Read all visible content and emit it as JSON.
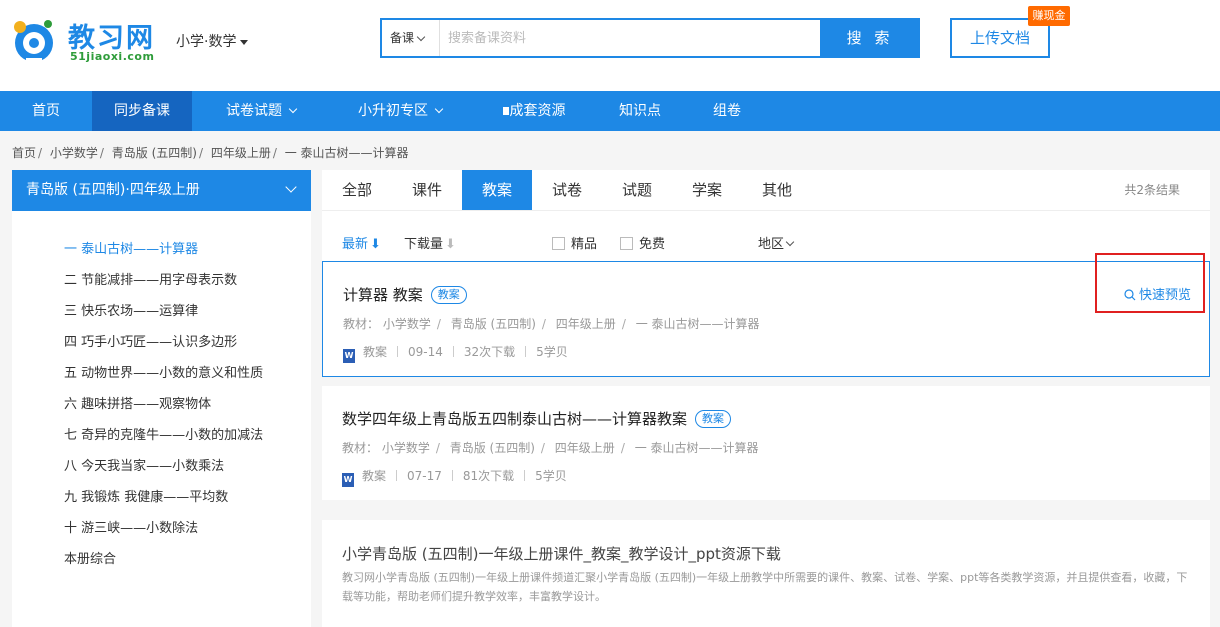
{
  "header": {
    "logo_text": "教习网",
    "logo_sub": "51jiaoxi.com",
    "subject": "小学·数学",
    "search_type": "备课",
    "search_placeholder": "搜索备课资料",
    "search_button": "搜 索",
    "upload_button": "上传文档",
    "earn_badge": "赚现金",
    "brand_color": "#1e88e5"
  },
  "nav": {
    "items": [
      {
        "label": "首页"
      },
      {
        "label": "同步备课"
      },
      {
        "label": "试卷试题"
      },
      {
        "label": "小升初专区"
      },
      {
        "label": "成套资源"
      },
      {
        "label": "知识点"
      },
      {
        "label": "组卷"
      }
    ],
    "active": "同步备课"
  },
  "breadcrumb": [
    "首页",
    "小学数学",
    "青岛版 (五四制)",
    "四年级上册",
    "一 泰山古树——计算器"
  ],
  "sidebar": {
    "header": "青岛版 (五四制)·四年级上册",
    "items": [
      {
        "label": "一 泰山古树——计算器"
      },
      {
        "label": "二 节能减排——用字母表示数"
      },
      {
        "label": "三 快乐农场——运算律"
      },
      {
        "label": "四 巧手小巧匠——认识多边形"
      },
      {
        "label": "五 动物世界——小数的意义和性质"
      },
      {
        "label": "六 趣味拼搭——观察物体"
      },
      {
        "label": "七 奇异的克隆牛——小数的加减法"
      },
      {
        "label": "八 今天我当家——小数乘法"
      },
      {
        "label": "九 我锻炼 我健康——平均数"
      },
      {
        "label": "十 游三峡——小数除法"
      },
      {
        "label": "本册综合"
      }
    ],
    "active_index": 0
  },
  "tabs": {
    "items": [
      {
        "label": "全部"
      },
      {
        "label": "课件"
      },
      {
        "label": "教案"
      },
      {
        "label": "试卷"
      },
      {
        "label": "试题"
      },
      {
        "label": "学案"
      },
      {
        "label": "其他"
      }
    ],
    "active": "教案",
    "total": "共2条结果"
  },
  "filters": {
    "newest": "最新",
    "newest_arrow": "⬇",
    "downloads": "下载量",
    "downloads_arrow": "⬇",
    "premium": "精品",
    "free": "免费",
    "region": "地区"
  },
  "results": [
    {
      "title": "计算器 教案",
      "tag": "教案",
      "meta_prefix": "教材：",
      "meta": [
        "小学数学",
        "青岛版 (五四制)",
        "四年级上册",
        "一 泰山古树——计算器"
      ],
      "type": "教案",
      "date": "09-14",
      "downloads": "32次下载",
      "cost": "5学贝",
      "preview": "快速预览"
    },
    {
      "title": "数学四年级上青岛版五四制泰山古树——计算器教案",
      "tag": "教案",
      "meta_prefix": "教材：",
      "meta": [
        "小学数学",
        "青岛版 (五四制)",
        "四年级上册",
        "一 泰山古树——计算器"
      ],
      "type": "教案",
      "date": "07-17",
      "downloads": "81次下载",
      "cost": "5学贝"
    }
  ],
  "seo": {
    "title": "小学青岛版 (五四制)一年级上册课件_教案_教学设计_ppt资源下载",
    "description": "教习网小学青岛版 (五四制)一年级上册课件频道汇聚小学青岛版 (五四制)一年级上册教学中所需要的课件、教案、试卷、学案、ppt等各类教学资源，并且提供查看，收藏，下载等功能，帮助老师们提升教学效率，丰富教学设计。"
  },
  "icons": {
    "logo": "owl-logo-icon",
    "search_type_chevron": "chevron-down-icon",
    "nav_chevron": "chevron-down-icon",
    "nav_square": "square-icon",
    "sidebar_chevron": "chevron-down-icon",
    "word_doc": "word-doc-icon",
    "preview": "search-icon"
  }
}
